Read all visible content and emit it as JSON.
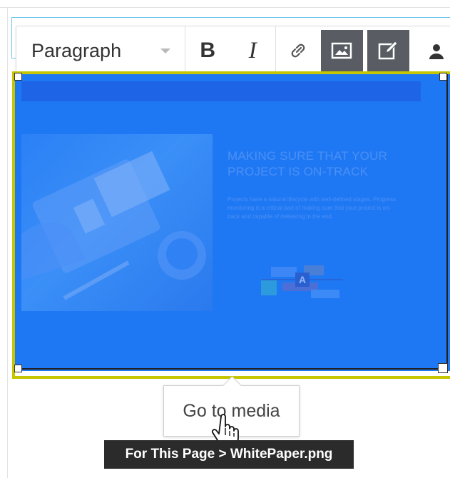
{
  "toolbar": {
    "format_value": "Paragraph",
    "bold_label": "B",
    "italic_label": "I",
    "buttons": [
      "link-icon",
      "image-icon",
      "edit-icon",
      "user-icon"
    ]
  },
  "image_content": {
    "heading": "MAKING SURE THAT YOUR PROJECT IS ON-TRACK",
    "body": "Projects have a natural lifecycle with well-defined stages. Progress monitoring is a critical part of making sure that your project is on-track and capable of delivering in the end.",
    "diagram_letter": "A"
  },
  "popup": {
    "label": "Go to media"
  },
  "tooltip": {
    "text": "For This Page > WhitePaper.png"
  },
  "colors": {
    "selection_overlay": "#1f78f3",
    "frame_border": "#c6c600",
    "active_button": "#595d63",
    "tooltip_bg": "#2b2b2b"
  }
}
